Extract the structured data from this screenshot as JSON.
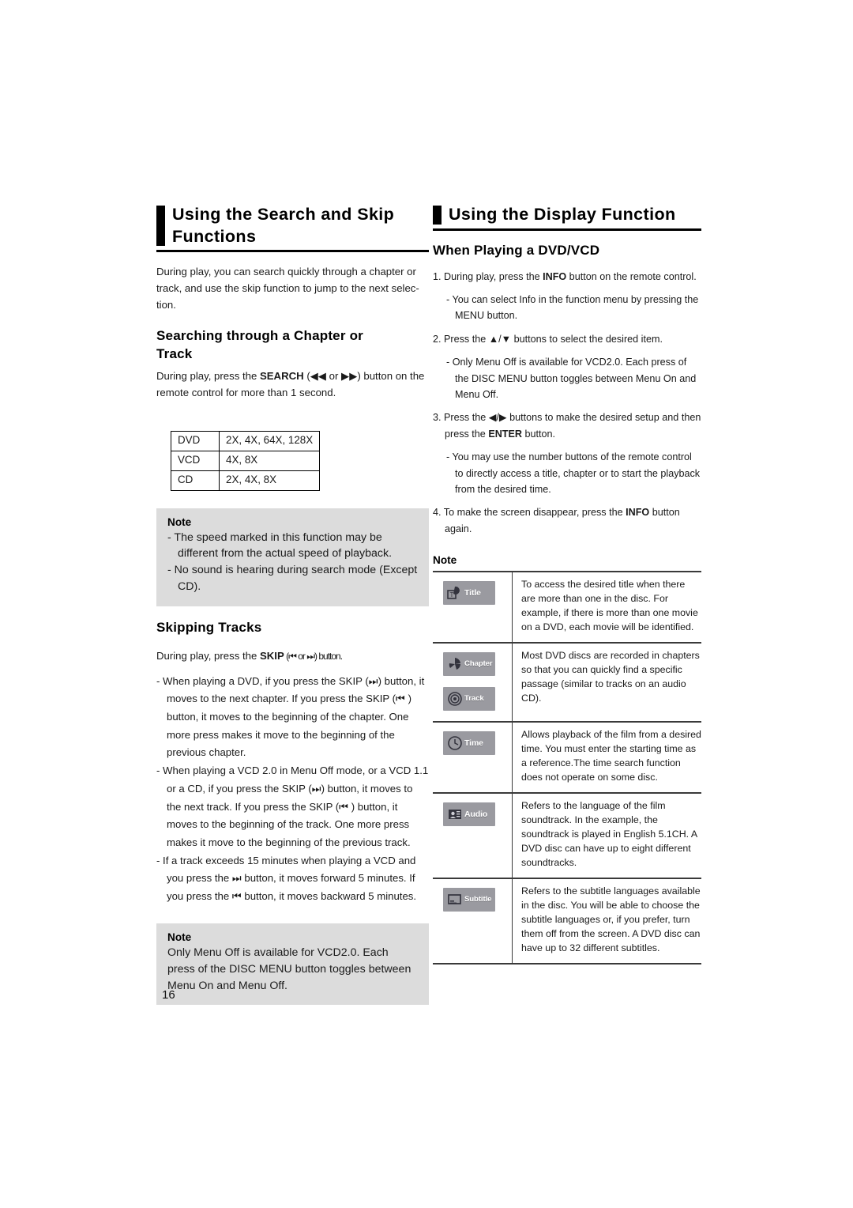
{
  "page_number": "16",
  "left_column": {
    "heading_line1": "Using the Search and Skip",
    "heading_line2": "Functions",
    "intro": "During play, you can search quickly through a chapter or track, and use the skip function to jump to the next selec-tion.",
    "search_section": {
      "heading_line1": "Searching through a Chapter or",
      "heading_line2": "Track",
      "instruction_a": "During play, press the ",
      "instruction_bold": "SEARCH",
      "instruction_b": " (◀◀ or ▶▶) button on the",
      "instruction_c": "remote control for more than 1 second."
    },
    "speed_table": {
      "rows": [
        {
          "disc": "DVD",
          "speeds": "2X, 4X, 64X, 128X"
        },
        {
          "disc": "VCD",
          "speeds": "4X, 8X"
        },
        {
          "disc": "CD",
          "speeds": "2X, 4X, 8X"
        }
      ]
    },
    "note_search": {
      "title": "Note",
      "items": [
        "- The speed marked in this function may be different from the actual speed of playback.",
        "- No sound is hearing during search mode (Except CD)."
      ]
    },
    "skip_section": {
      "heading": "Skipping Tracks",
      "instruction_a": "During play, press the ",
      "instruction_bold": "SKIP",
      "instruction_b": " (⏮  or ⏭) button.",
      "bullets": [
        "- When playing a DVD, if you press the SKIP (⏭) button, it moves to the next chapter. If you press the SKIP (⏮ ) button, it moves to the beginning of the chapter. One more press makes it move to the beginning of the previous chapter.",
        "- When playing a VCD 2.0 in Menu Off mode, or a VCD 1.1 or a CD, if you press the SKIP (⏭) button, it moves to the next track. If you press the SKIP (⏮ ) button, it moves to the beginning of the track. One more press makes it move to the beginning of the previous track.",
        "- If a track exceeds 15 minutes when playing a VCD and you press the ⏭ button, it moves forward 5 minutes. If you press the ⏮ button, it moves backward 5 minutes."
      ]
    },
    "note_skip": {
      "title": "Note",
      "text": "Only Menu Off is available for VCD2.0. Each press of the DISC MENU button toggles between Menu On and Menu Off."
    }
  },
  "right_column": {
    "heading": "Using the Display Function",
    "subheading": "When Playing a DVD/VCD",
    "steps": [
      {
        "num": "1.",
        "text_a": "During play, press the ",
        "bold": "INFO",
        "text_b": " button on the remote control."
      },
      {
        "num": "2.",
        "text_a": "Press the ▲/▼ buttons to select the desired item.",
        "bold": "",
        "text_b": ""
      },
      {
        "num": "3.",
        "text_a": "Press the ◀/▶ buttons to make the desired setup and then press the ",
        "bold": "ENTER",
        "text_b": " button."
      },
      {
        "num": "4.",
        "text_a": "To make the screen disappear, press the ",
        "bold": "INFO",
        "text_b": " button again."
      }
    ],
    "substeps": {
      "after_1": "- You can select Info in the function menu by pressing the MENU button.",
      "after_2": "- Only Menu Off is available for VCD2.0. Each press of the DISC MENU button toggles between Menu On and Menu Off.",
      "after_3": "- You may use the number buttons of the remote control to directly access a title, chapter or to start the playback from the desired time."
    },
    "note_label": "Note",
    "icon_table": [
      {
        "icons": [
          {
            "label": "Title",
            "glyph": "title-icon"
          }
        ],
        "description": "To access the desired title when there are more than one in the disc. For example, if there is more than one movie on a DVD, each movie will be identified."
      },
      {
        "icons": [
          {
            "label": "Chapter",
            "glyph": "chapter-icon"
          },
          {
            "label": "Track",
            "glyph": "track-icon"
          }
        ],
        "description": "Most DVD discs are recorded in chapters so that you can quickly find a specific passage (similar to tracks on an audio CD)."
      },
      {
        "icons": [
          {
            "label": "Time",
            "glyph": "time-icon"
          }
        ],
        "description": "Allows playback of the film from a desired time. You must enter the starting time as a reference.The time search function does not operate on some disc."
      },
      {
        "icons": [
          {
            "label": "Audio",
            "glyph": "audio-icon"
          }
        ],
        "description": "Refers to the language of the film soundtrack. In the example, the soundtrack is played in English 5.1CH. A DVD disc can have up to eight different soundtracks."
      },
      {
        "icons": [
          {
            "label": "Subtitle",
            "glyph": "subtitle-icon"
          }
        ],
        "description": "Refers to the subtitle languages available in the disc. You will be able to choose the subtitle languages or, if you prefer, turn them off from the screen. A DVD disc can have up to 32 different subtitles."
      }
    ]
  },
  "colors": {
    "note_background": "#dcdcdc",
    "badge_background": "#9a9aa0",
    "rule": "#3a3a3a"
  }
}
